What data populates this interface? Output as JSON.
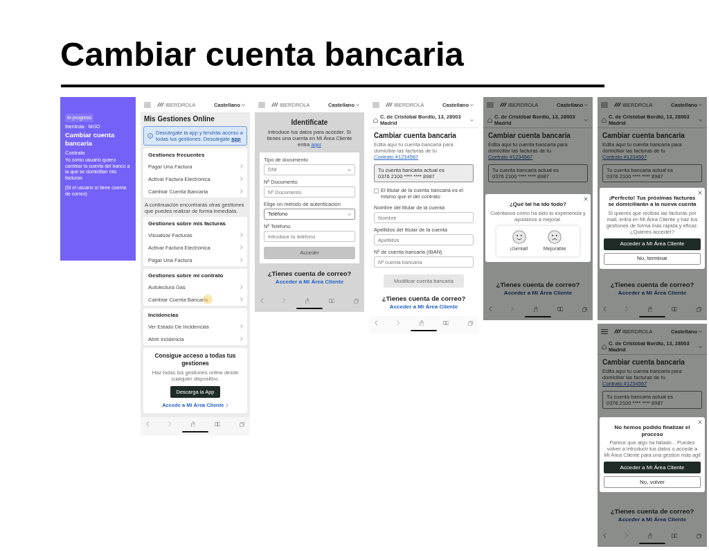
{
  "page": {
    "title": "Cambiar cuenta bancaria"
  },
  "story_card": {
    "status": "In progress",
    "meta": "Iberdrola · MGO",
    "title": "Cambiar cuenta bancaria",
    "section": "Contrato",
    "description": "Yo como usuario quiero cambiar la cuenta del banco a la que se domicilian mis facturas",
    "condition": "(Si el usuario sí tiene cuenta de correo)"
  },
  "screens": [
    {
      "kind": "gestiones",
      "brand": "IBERDROLA",
      "language": "Castellano",
      "heading": "Mis Gestiones Online",
      "notice": {
        "text": "Descárgate la app y tendrás acceso a todas tus gestiones. Descárgate",
        "link": "app"
      },
      "sections": [
        {
          "kind": "group",
          "title": "Gestiones frecuentes",
          "items": [
            {
              "label": "Pagar Una Factura",
              "tapped": false
            },
            {
              "label": "Activar Factura Electrónica",
              "tapped": false
            },
            {
              "label": "Cambiar Cuenta Bancaria",
              "tapped": false
            }
          ]
        },
        {
          "kind": "note",
          "text": "A continuación encontrarás otras gestiones que puedes realizar de forma inmediata."
        },
        {
          "kind": "group",
          "title": "Gestiones sobre mis facturas",
          "items": [
            {
              "label": "Visualizar Facturas",
              "tapped": false
            },
            {
              "label": "Activar Factura Electrónica",
              "tapped": false
            },
            {
              "label": "Pagar Una Factura",
              "tapped": false
            }
          ]
        },
        {
          "kind": "group",
          "title": "Gestiones sobre mi contrato",
          "items": [
            {
              "label": "Autolectura Gas",
              "tapped": false
            },
            {
              "label": "Cambiar Cuenta Bancaria",
              "tapped": true
            }
          ]
        },
        {
          "kind": "group",
          "title": "Incidencias",
          "items": [
            {
              "label": "Ver Estado De Incidencias",
              "tapped": false
            },
            {
              "label": "Abrir Incidencia",
              "tapped": false
            }
          ]
        }
      ],
      "promo": {
        "title": "Consigue acceso a todas tus gestiones",
        "text": "Haz todas tus gestiones online desde cualquier dispositivo.",
        "button": "Descarga la App",
        "link": "Accede a Mi Área Cliente"
      }
    },
    {
      "kind": "login",
      "brand": "IBERDROLA",
      "language": "Castellano",
      "heading": "Identifícate",
      "intro": "Introduce tus datos para acceder. Si tienes una cuenta en Mi Área Cliente entra",
      "intro_link": "aquí",
      "fields": [
        {
          "kind": "select",
          "label": "Tipo de documento",
          "placeholder": "DNI"
        },
        {
          "kind": "text",
          "label": "Nº Documento",
          "placeholder": "Nº Documento"
        },
        {
          "kind": "select",
          "label": "Elige un método de autenticación",
          "value": "Teléfono"
        },
        {
          "kind": "text",
          "label": "Nº Teléfono",
          "placeholder": "Introduce tu teléfono"
        }
      ],
      "submit": {
        "label": "Acceder",
        "disabled": true
      },
      "footer": {
        "question": "¿Tienes cuenta de correo?",
        "link": "Acceder a Mi Área Cliente"
      }
    },
    {
      "kind": "form",
      "brand": "IBERDROLA",
      "language": "Castellano",
      "address": "C. de Cristóbal Bordiú, 13, 28003 Madrid",
      "heading": "Cambiar cuenta bancaria",
      "intro": "Edita aquí tu cuenta bancaria para domiciliar las facturas de tu",
      "intro_link": "Contrato #1234567",
      "account": [
        "Tu cuenta bancaria actual es",
        "0376 2100 **** **** 8987"
      ],
      "holder_check": {
        "label": "El titular de la cuenta bancaria es el mismo que el del contrato",
        "checked": false
      },
      "fields": [
        {
          "kind": "text",
          "label": "Nombre del titular de la cuenta",
          "placeholder": "Nombre"
        },
        {
          "kind": "text",
          "label": "Apellidos del titular de la cuenta",
          "placeholder": "Apellidos"
        },
        {
          "kind": "text",
          "label": "Nº de cuenta bancaria (IBAN)",
          "placeholder": "Nº cuenta bancaria"
        }
      ],
      "submit": {
        "label": "Modificar cuenta bancaria",
        "disabled": true
      },
      "footer": {
        "question": "¿Tienes cuenta de correo?",
        "link": "Acceder a Mi Área Cliente"
      }
    },
    {
      "kind": "form",
      "brand": "IBERDROLA",
      "language": "Castellano",
      "address": "C. de Cristóbal Bordiú, 13, 28003 Madrid",
      "heading": "Cambiar cuenta bancaria",
      "intro": "Edita aquí tu cuenta bancaria para domiciliar las facturas de tu",
      "intro_link": "Contrato #1234567",
      "account": [
        "Tu cuenta bancaria actual es",
        "0376 2100 **** **** 8987"
      ],
      "footer": {
        "question": "¿Tienes cuenta de correo?",
        "link": "Acceder a Mi Área Cliente"
      },
      "modal": {
        "kind": "rating",
        "title": "¿Qué tal ha ido todo?",
        "text": "Cuéntanos cómo ha sido tu experiencia y ayúdanos a mejorar.",
        "options": [
          {
            "label": "¡Genial!",
            "kind": "happy"
          },
          {
            "label": "Mejorable",
            "kind": "sad"
          }
        ]
      }
    },
    {
      "kind": "form",
      "brand": "IBERDROLA",
      "language": "Castellano",
      "address": "C. de Cristóbal Bordiú, 13, 28003 Madrid",
      "heading": "Cambiar cuenta bancaria",
      "intro": "Edita aquí tu cuenta bancaria para domiciliar las facturas de tu",
      "intro_link": "Contrato #1234567",
      "account": [
        "Tu cuenta bancaria actual es",
        "0376 2100 **** **** 8987"
      ],
      "footer": {
        "question": "¿Tienes cuenta de correo?",
        "link": "Acceder a Mi Área Cliente"
      },
      "modal": {
        "kind": "message",
        "title": "¡Perfecto! Tus próximas facturas se domiciliarán a la nueva cuenta",
        "text": "Si quieres que recibas las facturas por mail, entra en Mi Área Cliente y haz tus gestiones de forma más rápida y eficaz. ¿Quieres acceder?",
        "buttons": [
          {
            "label": "Acceder a Mi Área Cliente",
            "kind": "primary"
          },
          {
            "label": "No, terminar",
            "kind": "secondary"
          }
        ]
      }
    },
    {
      "kind": "form",
      "brand": "IBERDROLA",
      "language": "Castellano",
      "address": "C. de Cristóbal Bordiú, 13, 28003 Madrid",
      "heading": "Cambiar cuenta bancaria",
      "intro": "Edita aquí tu cuenta bancaria para domiciliar las facturas de tu",
      "intro_link": "Contrato #1234567",
      "account": [
        "Tu cuenta bancaria actual es",
        "0376 2100 **** **** 8987"
      ],
      "footer": {
        "question": "¿Tienes cuenta de correo?",
        "link": "Acceder a Mi Área Cliente"
      },
      "modal": {
        "kind": "message",
        "title": "No hemos podido finalizar el proceso",
        "text": "Parece que algo ha fallado... Puedes volver a introducir tus datos o accede a Mi Área Cliente para una gestión más ágil",
        "buttons": [
          {
            "label": "Acceder a Mi Área Cliente",
            "kind": "primary"
          },
          {
            "label": "No, volver",
            "kind": "secondary"
          }
        ]
      }
    }
  ]
}
